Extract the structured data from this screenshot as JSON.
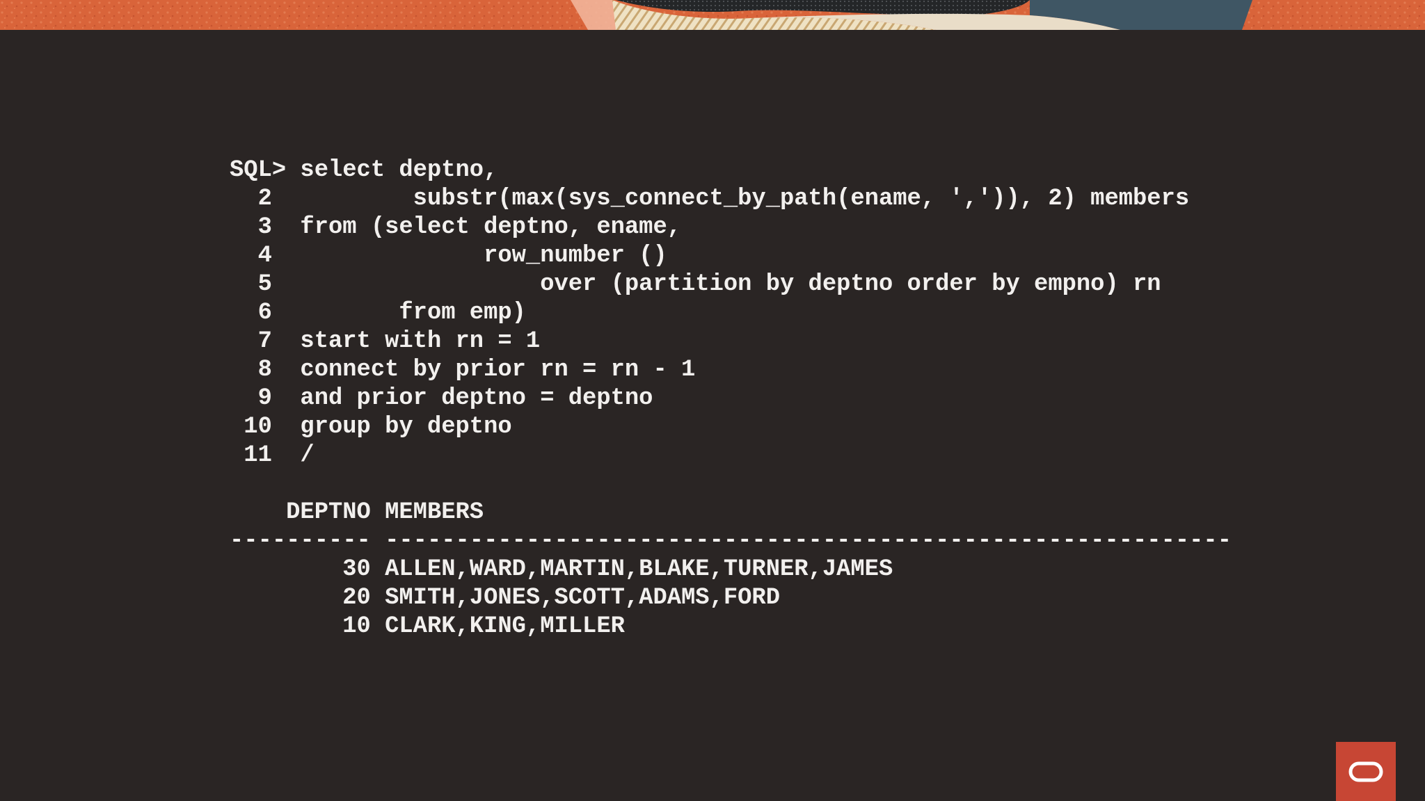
{
  "console": {
    "lines": [
      {
        "num": "SQL>",
        "code": " select deptno,"
      },
      {
        "num": "  2 ",
        "code": "         substr(max(sys_connect_by_path(ename, ',')), 2) members"
      },
      {
        "num": "  3 ",
        "code": " from (select deptno, ename,"
      },
      {
        "num": "  4 ",
        "code": "              row_number ()"
      },
      {
        "num": "  5 ",
        "code": "                  over (partition by deptno order by empno) rn"
      },
      {
        "num": "  6 ",
        "code": "        from emp)"
      },
      {
        "num": "  7 ",
        "code": " start with rn = 1"
      },
      {
        "num": "  8 ",
        "code": " connect by prior rn = rn - 1"
      },
      {
        "num": "  9 ",
        "code": " and prior deptno = deptno"
      },
      {
        "num": " 10 ",
        "code": " group by deptno"
      },
      {
        "num": " 11 ",
        "code": " /"
      }
    ],
    "result": {
      "header": "    DEPTNO MEMBERS",
      "separator": "---------- ------------------------------------------------------------",
      "rows": [
        "        30 ALLEN,WARD,MARTIN,BLAKE,TURNER,JAMES",
        "        20 SMITH,JONES,SCOTT,ADAMS,FORD",
        "        10 CLARK,KING,MILLER"
      ]
    }
  },
  "colors": {
    "background": "#2a2524",
    "text": "#f2f0ee",
    "brand": "#c74634",
    "banner_orange": "#d9643a"
  },
  "icons": {
    "logo": "oracle-logo-icon"
  }
}
